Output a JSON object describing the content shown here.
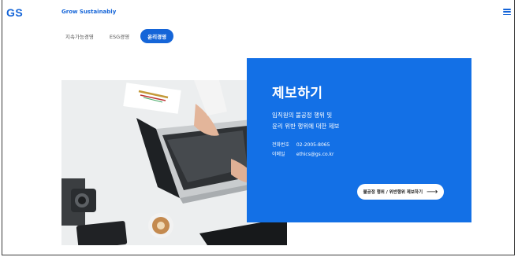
{
  "header": {
    "logo": "GS",
    "tagline": "Grow Sustainably",
    "menu_icon": "hamburger-menu-icon"
  },
  "tabs": [
    {
      "label": "지속가능경영",
      "active": false
    },
    {
      "label": "ESG경영",
      "active": false
    },
    {
      "label": "윤리경영",
      "active": true
    }
  ],
  "hero": {
    "image": "laptop-desk-photo",
    "title": "제보하기",
    "description_line1": "임직원의 불공정 행위 및",
    "description_line2": "윤리 위반 행위에 대한 제보",
    "phone_label": "전화번호",
    "phone_value": "02-2005-8065",
    "email_label": "이메일",
    "email_value": "ethics@gs.co.kr",
    "button_label": "불공정 행위 / 위반행위 제보하기",
    "button_icon": "arrow-right-icon"
  },
  "colors": {
    "brand": "#1565d8",
    "card": "#1370e6"
  }
}
